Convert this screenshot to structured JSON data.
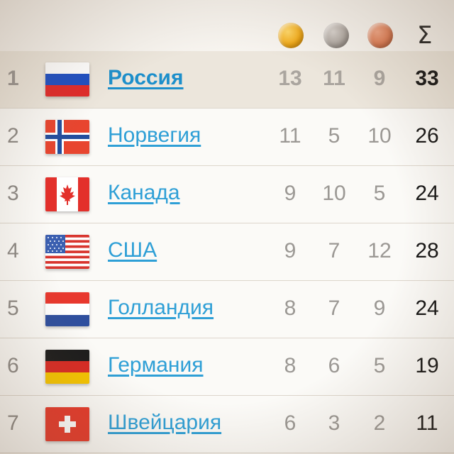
{
  "header": {
    "medals": [
      "gold-medal-icon",
      "silver-medal-icon",
      "bronze-medal-icon"
    ],
    "total_symbol": "Σ",
    "colors": {
      "gold": "#f0a714",
      "silver": "#a9a29c",
      "bronze": "#d9774f",
      "link": "#2e9fd6",
      "highlight": "#ece6dc"
    }
  },
  "standings": [
    {
      "rank": "1",
      "country": "Россия",
      "gold": "13",
      "silver": "11",
      "bronze": "9",
      "total": "33",
      "flag": "russia-flag-icon"
    },
    {
      "rank": "2",
      "country": "Норвегия",
      "gold": "11",
      "silver": "5",
      "bronze": "10",
      "total": "26",
      "flag": "norway-flag-icon"
    },
    {
      "rank": "3",
      "country": "Канада",
      "gold": "9",
      "silver": "10",
      "bronze": "5",
      "total": "24",
      "flag": "canada-flag-icon"
    },
    {
      "rank": "4",
      "country": "США",
      "gold": "9",
      "silver": "7",
      "bronze": "12",
      "total": "28",
      "flag": "usa-flag-icon"
    },
    {
      "rank": "5",
      "country": "Голландия",
      "gold": "8",
      "silver": "7",
      "bronze": "9",
      "total": "24",
      "flag": "netherlands-flag-icon"
    },
    {
      "rank": "6",
      "country": "Германия",
      "gold": "8",
      "silver": "6",
      "bronze": "5",
      "total": "19",
      "flag": "germany-flag-icon"
    },
    {
      "rank": "7",
      "country": "Швейцария",
      "gold": "6",
      "silver": "3",
      "bronze": "2",
      "total": "11",
      "flag": "switzerland-flag-icon"
    }
  ]
}
